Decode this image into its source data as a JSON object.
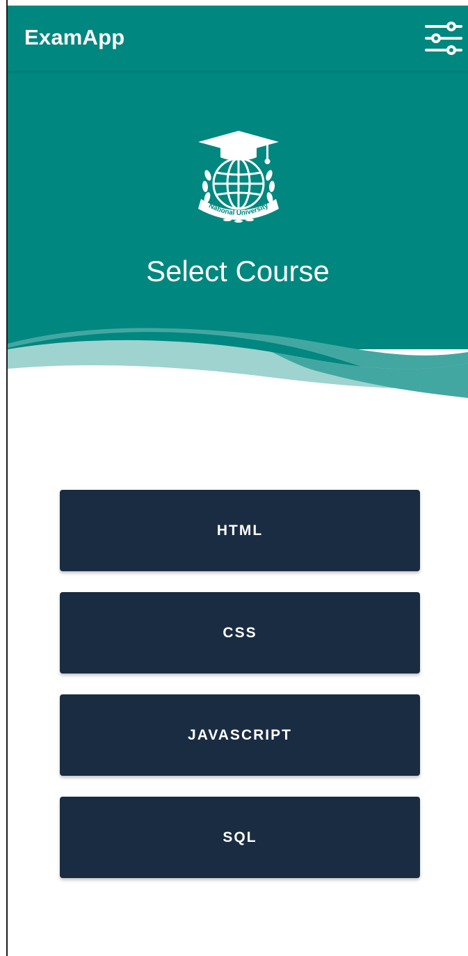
{
  "app_bar": {
    "title": "ExamApp",
    "settings_icon": "sliders-icon"
  },
  "hero": {
    "logo_text": "National University",
    "title": "Select Course"
  },
  "courses": [
    {
      "label": "HTML"
    },
    {
      "label": "CSS"
    },
    {
      "label": "JAVASCRIPT"
    },
    {
      "label": "SQL"
    }
  ],
  "colors": {
    "primary": "#00877f",
    "wave_light": "#9ed3d0",
    "wave_mid": "#43a7a1",
    "button": "#1a2c42",
    "text_on_primary": "#ffffff"
  }
}
